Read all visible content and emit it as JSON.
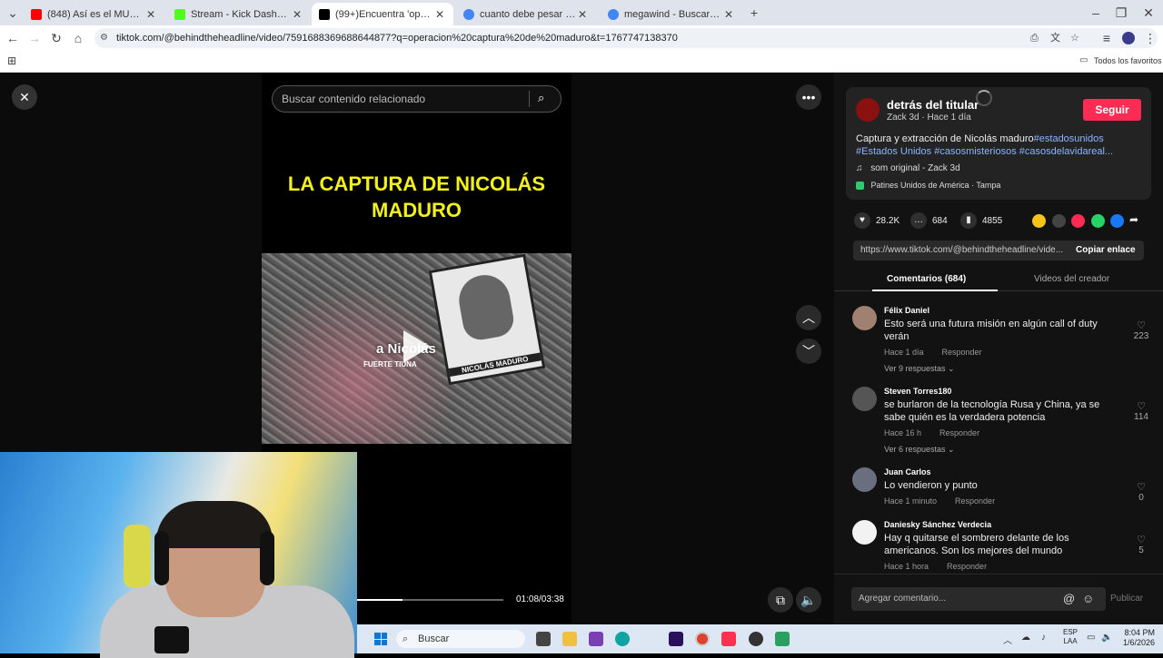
{
  "browser": {
    "tabs": [
      {
        "label": "(848) Así es el MUNDO de HARRY",
        "favicon_color": "#ff0000"
      },
      {
        "label": "Stream - Kick Dashboard",
        "favicon_color": "#53fc18"
      },
      {
        "label": "(99+)Encuentra 'operacion captura de maduro'",
        "favicon_color": "#000000"
      },
      {
        "label": "cuanto debe pesar uno segun la estatura",
        "favicon_color": "#4285f4"
      },
      {
        "label": "megawind - Buscar con Google",
        "favicon_color": "#4285f4"
      }
    ],
    "new_tab": "+",
    "url": "tiktok.com/@behindtheheadline/video/7591688369688644877?q=operacion%20captura%20de%20maduro&t=1767747138370",
    "bookmarks_label": "Todos los favoritos"
  },
  "video": {
    "search_placeholder": "Buscar contenido relacionado",
    "headline": "LA CAPTURA DE NICOLÁS MADURO",
    "photo_label": "NICOLÁS MADURO",
    "overlay_caption": "a Nicolás",
    "overlay_sub": "FUERTE TIUNA",
    "time": "01:08/03:38",
    "progress_fraction": 0.31
  },
  "creator": {
    "name": "detrás del titular",
    "meta": "Zack 3d · Hace 1 día",
    "follow_label": "Seguir",
    "desc_text": "Captura y extracción de Nicolás maduro",
    "desc_tags": "#estadosunidos #Estados Unidos #casosmisteriosos #casosdelavidareal...",
    "sound": "som original - Zack 3d",
    "location": "Patines Unidos de América · Tampa"
  },
  "stats": {
    "likes": "28.2K",
    "comments": "684",
    "saves": "4855"
  },
  "link": {
    "url": "https://www.tiktok.com/@behindtheheadline/vide...",
    "copy_label": "Copiar enlace"
  },
  "panel_tabs": {
    "comments": "Comentarios (684)",
    "creator_videos": "Videos del creador"
  },
  "comments": [
    {
      "name": "Félix Daniel",
      "text": "Esto será una futura misión en algún call of duty verán",
      "time": "Hace 1 día",
      "reply": "Responder",
      "replies": "Ver 9 respuestas",
      "likes": "223"
    },
    {
      "name": "Steven Torres180",
      "text": "se burlaron de la tecnología Rusa y China, ya se sabe quién es la verdadera potencia",
      "time": "Hace 16 h",
      "reply": "Responder",
      "replies": "Ver 6 respuestas",
      "likes": "114"
    },
    {
      "name": "Juan Carlos",
      "text": "Lo vendieron y punto",
      "time": "Hace 1 minuto",
      "reply": "Responder",
      "replies": "",
      "likes": "0"
    },
    {
      "name": "Daniesky Sánchez Verdecia",
      "text": "Hay q quitarse el sombrero delante de los americanos. Son los mejores del mundo",
      "time": "Hace 1 hora",
      "reply": "Responder",
      "replies": "",
      "likes": "5"
    }
  ],
  "comment_box": {
    "placeholder": "Agregar comentario...",
    "publish": "Publicar"
  },
  "taskbar": {
    "search": "Buscar",
    "lang1": "ESP",
    "lang2": "LAA",
    "time": "8:04 PM",
    "date": "1/6/2026"
  },
  "colors": {
    "accent": "#fe2c55",
    "tag": "#8bb4ff",
    "headline": "#f2f21a"
  }
}
